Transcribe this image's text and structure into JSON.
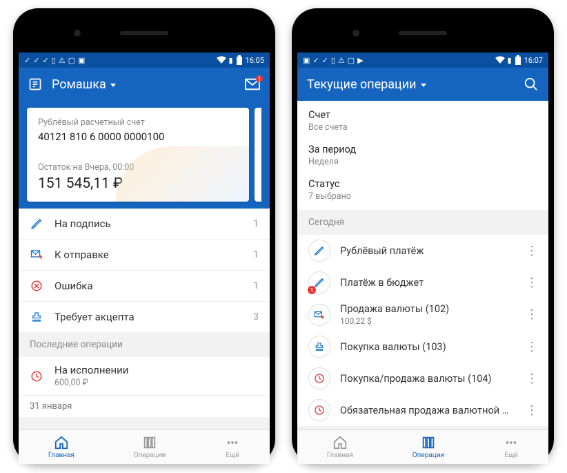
{
  "left": {
    "status_time": "16:05",
    "app_title": "Ромашка",
    "mail_badge": "1",
    "card": {
      "type_label": "Рублёвый расчетный счет",
      "account_number": "40121 810 6 0000 0000100",
      "balance_label": "Остаток на Вчера, 00:00",
      "balance": "151 545,11 ₽"
    },
    "rows": [
      {
        "icon": "pen-icon",
        "label": "На подпись",
        "count": "1"
      },
      {
        "icon": "mail-send-icon",
        "label": "К отправке",
        "count": "1"
      },
      {
        "icon": "error-icon",
        "label": "Ошибка",
        "count": "1"
      },
      {
        "icon": "stamp-icon",
        "label": "Требует акцепта",
        "count": "3"
      }
    ],
    "section_recent": "Последние операции",
    "recent": {
      "title": "На исполнении",
      "amount": "600,00 ₽"
    },
    "date_row": "31 января",
    "nav": {
      "home": "Главная",
      "ops": "Операции",
      "more": "Ещё"
    }
  },
  "right": {
    "status_time": "16:07",
    "app_title": "Текущие операции",
    "filters": [
      {
        "label": "Счет",
        "value": "Все счета"
      },
      {
        "label": "За период",
        "value": "Неделя"
      },
      {
        "label": "Статус",
        "value": "7 выбрано"
      }
    ],
    "section_today": "Сегодня",
    "ops": [
      {
        "icon": "pen-icon",
        "name": "Рублёвый платёж",
        "amount": "",
        "badge": ""
      },
      {
        "icon": "pen-icon",
        "name": "Платёж в бюджет",
        "amount": "",
        "badge": "1"
      },
      {
        "icon": "mail-send-icon",
        "name": "Продажа валюты (102)",
        "amount": "100,22 $",
        "badge": ""
      },
      {
        "icon": "stamp-icon",
        "name": "Покупка валюты (103)",
        "amount": "",
        "badge": ""
      },
      {
        "icon": "clock-icon",
        "name": "Покупка/продажа валюты (104)",
        "amount": "",
        "badge": ""
      },
      {
        "icon": "clock-icon",
        "name": "Обязательная продажа валютной вы…",
        "amount": "",
        "badge": ""
      }
    ],
    "nav": {
      "home": "Главная",
      "ops": "Операции",
      "more": "Ещё"
    }
  }
}
